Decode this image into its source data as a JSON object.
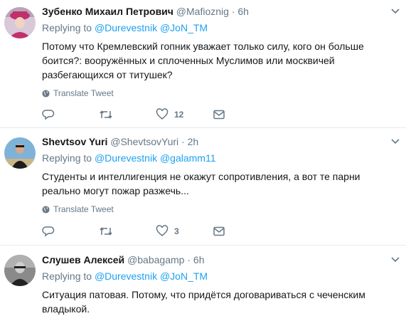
{
  "tweets": [
    {
      "fullname": "Зубенко Михаил Петрович",
      "username": "@Mafioznig",
      "separator": "·",
      "time": "6h",
      "replying_prefix": "Replying to",
      "mentions": [
        "@Durevestnik",
        "@JoN_TM"
      ],
      "text": "Потому что Кремлевский гопник уважает только силу, кого он больше боится?:  вооружённых и сплоченных Муслимов или москвичей разбегающихся от титушек?",
      "translate": "Translate Tweet",
      "like_count": "12",
      "avatar_colors": {
        "bg": "#d9c8d8",
        "accent": "#c0306a"
      }
    },
    {
      "fullname": "Shevtsov Yuri",
      "username": "@ShevtsovYuri",
      "separator": "·",
      "time": "2h",
      "replying_prefix": "Replying to",
      "mentions": [
        "@Durevestnik",
        "@galamm11"
      ],
      "text": "Студенты и интеллигенция не окажут сопротивления, а вот те парни реально могут пожар разжечь...",
      "translate": "Translate Tweet",
      "like_count": "3",
      "avatar_colors": {
        "bg": "#7fb2d8",
        "accent": "#1c1c1c"
      }
    },
    {
      "fullname": "Слушев Алексей",
      "username": "@babagamp",
      "separator": "·",
      "time": "6h",
      "replying_prefix": "Replying to",
      "mentions": [
        "@Durevestnik",
        "@JoN_TM"
      ],
      "text": "Ситуация патовая. Потому, что придётся договариваться с чеченским владыкой.",
      "avatar_colors": {
        "bg": "#8a8a8a",
        "accent": "#222222"
      }
    }
  ],
  "icons": {
    "caret": "chevron-down-icon",
    "globe": "globe-icon",
    "reply": "reply-icon",
    "retweet": "retweet-icon",
    "like": "heart-icon",
    "dm": "envelope-icon"
  },
  "colors": {
    "link": "#1da1f2",
    "meta": "#657786",
    "text": "#14171a",
    "divider": "#e6ecf0"
  }
}
